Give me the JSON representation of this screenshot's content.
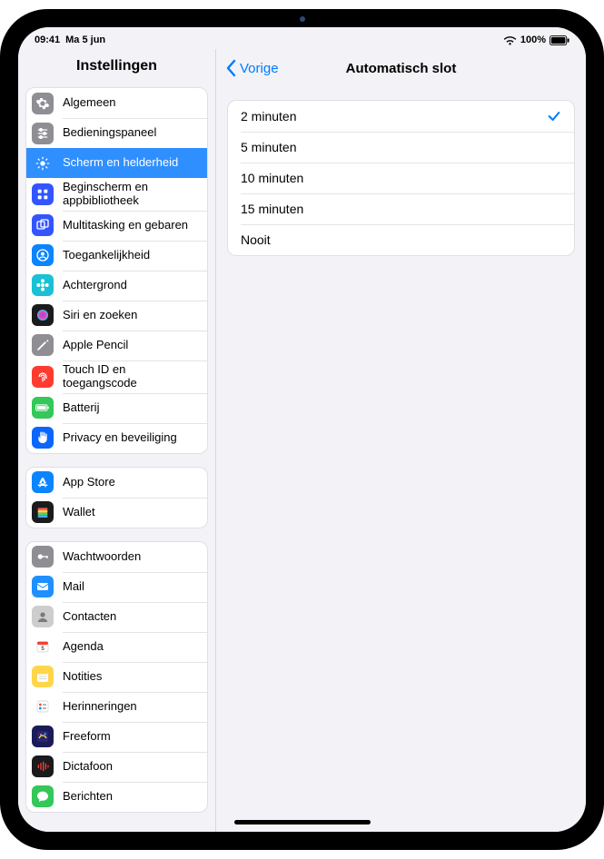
{
  "status": {
    "time": "09:41",
    "date": "Ma 5 jun",
    "battery_pct": "100%"
  },
  "sidebar": {
    "title": "Instellingen",
    "groups": [
      {
        "items": [
          {
            "id": "general",
            "label": "Algemeen",
            "icon": "gear",
            "bg": "#8e8e93"
          },
          {
            "id": "control",
            "label": "Bedieningspaneel",
            "icon": "sliders",
            "bg": "#8e8e93"
          },
          {
            "id": "display",
            "label": "Scherm en helderheid",
            "icon": "sun",
            "bg": "#2f8fff",
            "selected": true
          },
          {
            "id": "home",
            "label": "Beginscherm en appbibliotheek",
            "icon": "grid",
            "bg": "#3355ff"
          },
          {
            "id": "multitask",
            "label": "Multitasking en gebaren",
            "icon": "rects",
            "bg": "#3355ff"
          },
          {
            "id": "accessibility",
            "label": "Toegankelijkheid",
            "icon": "person",
            "bg": "#0a84ff"
          },
          {
            "id": "wallpaper",
            "label": "Achtergrond",
            "icon": "flower",
            "bg": "#18c1d6"
          },
          {
            "id": "siri",
            "label": "Siri en zoeken",
            "icon": "siri",
            "bg": "#1b1b1d"
          },
          {
            "id": "pencil",
            "label": "Apple Pencil",
            "icon": "pencil",
            "bg": "#8e8e93"
          },
          {
            "id": "touchid",
            "label": "Touch ID en toegangscode",
            "icon": "finger",
            "bg": "#ff3b30"
          },
          {
            "id": "battery",
            "label": "Batterij",
            "icon": "battery",
            "bg": "#34c759"
          },
          {
            "id": "privacy",
            "label": "Privacy en beveiliging",
            "icon": "hand",
            "bg": "#0a66ff"
          }
        ]
      },
      {
        "items": [
          {
            "id": "appstore",
            "label": "App Store",
            "icon": "appstore",
            "bg": "#0a84ff"
          },
          {
            "id": "wallet",
            "label": "Wallet",
            "icon": "wallet",
            "bg": "#1b1b1d"
          }
        ]
      },
      {
        "items": [
          {
            "id": "passwords",
            "label": "Wachtwoorden",
            "icon": "key",
            "bg": "#8e8e93"
          },
          {
            "id": "mail",
            "label": "Mail",
            "icon": "mail",
            "bg": "#1e90ff"
          },
          {
            "id": "contacts",
            "label": "Contacten",
            "icon": "contact",
            "bg": "#cdcdcd"
          },
          {
            "id": "calendar",
            "label": "Agenda",
            "icon": "calendar",
            "bg": "#ffffff"
          },
          {
            "id": "notes",
            "label": "Notities",
            "icon": "notes",
            "bg": "#ffd54a"
          },
          {
            "id": "reminders",
            "label": "Herinneringen",
            "icon": "reminders",
            "bg": "#ffffff"
          },
          {
            "id": "freeform",
            "label": "Freeform",
            "icon": "freeform",
            "bg": "#1b1b5a"
          },
          {
            "id": "voicememo",
            "label": "Dictafoon",
            "icon": "voice",
            "bg": "#1b1b1d"
          },
          {
            "id": "messages",
            "label": "Berichten",
            "icon": "messages",
            "bg": "#34c759"
          }
        ]
      }
    ]
  },
  "detail": {
    "back_label": "Vorige",
    "title": "Automatisch slot",
    "options": [
      {
        "label": "2 minuten",
        "selected": true
      },
      {
        "label": "5 minuten",
        "selected": false
      },
      {
        "label": "10 minuten",
        "selected": false
      },
      {
        "label": "15 minuten",
        "selected": false
      },
      {
        "label": "Nooit",
        "selected": false
      }
    ]
  }
}
